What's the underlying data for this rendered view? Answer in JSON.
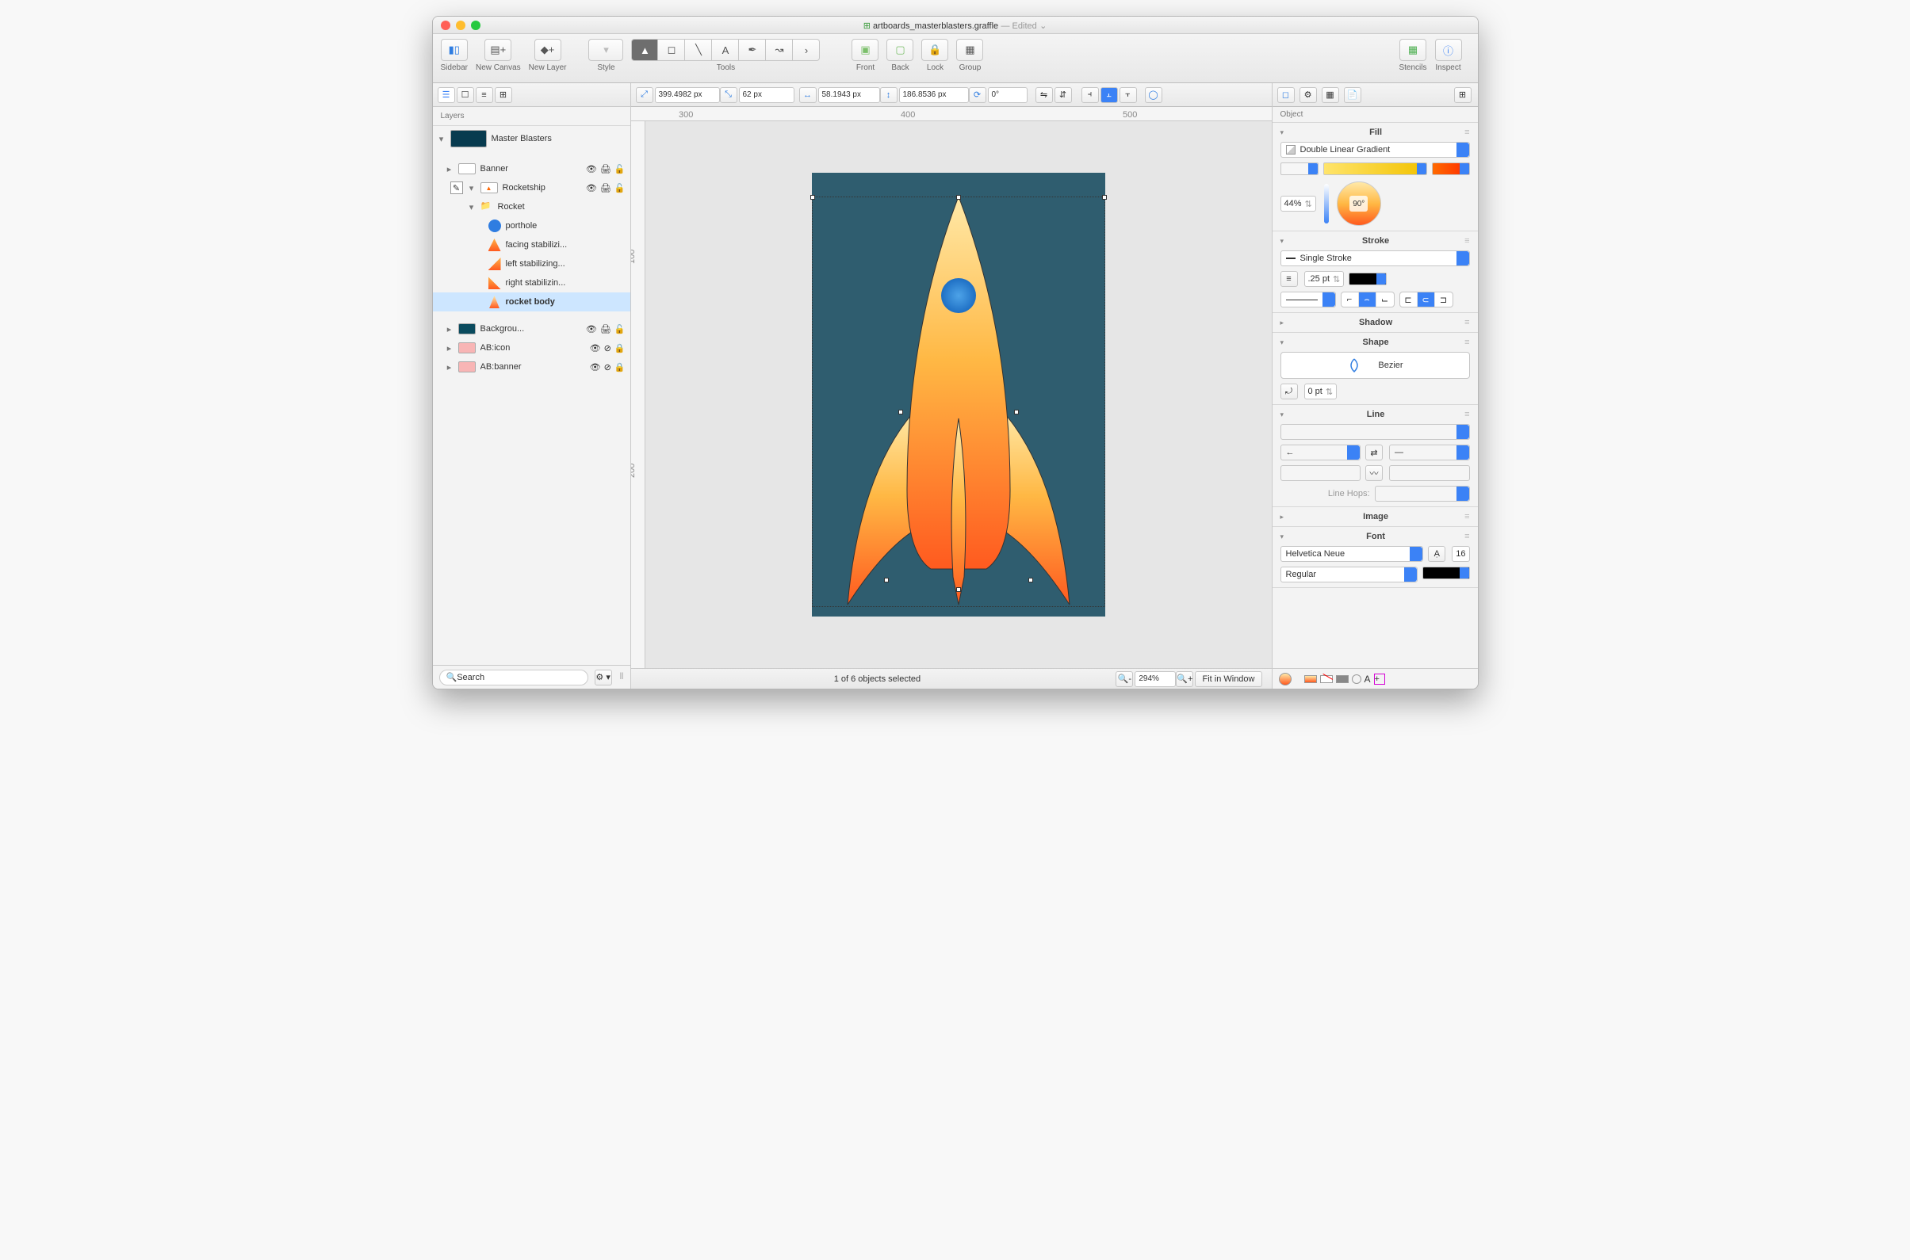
{
  "window": {
    "filename": "artboards_masterblasters.graffle",
    "status": " — Edited"
  },
  "toolbar": {
    "sidebar": "Sidebar",
    "new_canvas": "New Canvas",
    "new_layer": "New Layer",
    "style": "Style",
    "tools": "Tools",
    "front": "Front",
    "back": "Back",
    "lock": "Lock",
    "group": "Group",
    "stencils": "Stencils",
    "inspect": "Inspect"
  },
  "options": {
    "x": "399.4982 px",
    "y": "62 px",
    "w": "58.1943 px",
    "h": "186.8536 px",
    "rotation": "0°"
  },
  "left": {
    "heading": "Layers",
    "canvas": "Master Blasters",
    "layers": {
      "banner": "Banner",
      "rocketship": "Rocketship",
      "rocket_group": "Rocket",
      "porthole": "porthole",
      "facing_fin": "facing stabilizi...",
      "left_fin": "left stabilizing...",
      "right_fin": "right stabilizin...",
      "rocket_body": "rocket body",
      "background": "Backgrou...",
      "ab_icon": "AB:icon",
      "ab_banner": "AB:banner"
    },
    "search_placeholder": "Search"
  },
  "status_bar": {
    "selection": "1 of 6 objects selected",
    "zoom": "294%",
    "fit": "Fit in Window"
  },
  "inspector": {
    "heading": "Object",
    "fill": {
      "title": "Fill",
      "type": "Double Linear Gradient",
      "mid_stop": "44%",
      "angle": "90°"
    },
    "stroke": {
      "title": "Stroke",
      "type": "Single Stroke",
      "width": ".25 pt"
    },
    "shadow": {
      "title": "Shadow"
    },
    "shape": {
      "title": "Shape",
      "type": "Bezier",
      "corner": "0 pt"
    },
    "line": {
      "title": "Line",
      "hops_label": "Line Hops:"
    },
    "image": {
      "title": "Image"
    },
    "font": {
      "title": "Font",
      "family": "Helvetica Neue",
      "size": "16",
      "weight": "Regular"
    }
  }
}
